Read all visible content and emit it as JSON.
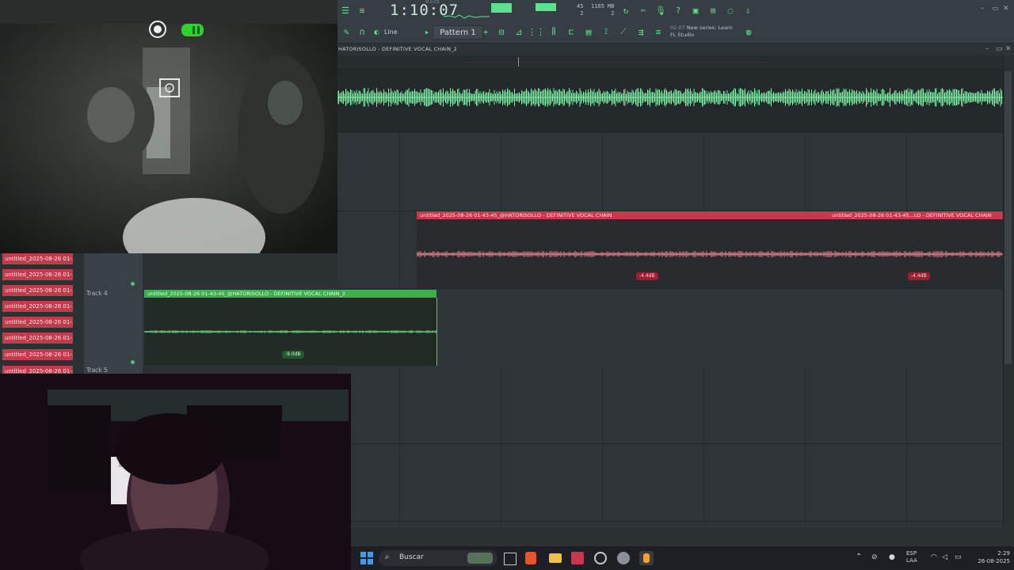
{
  "toolbar": {
    "clock": "1:10:07",
    "clock_sub": "M:S:CS",
    "voices": "45",
    "voices_sub": "2",
    "memory": "1165 MB",
    "memory_sub": "2",
    "snap": "Line",
    "pattern": "Pattern 1",
    "hint_date": "02:07",
    "hint_title": "New series: Learn",
    "hint_sub": "FL Studio"
  },
  "playlist": {
    "title": "HATORISOLLO - DEFINITIVE VOCAL CHAIN_2"
  },
  "red_clip": {
    "label_left": "untitled_2025-08-26 01-43-45_@HATORISOLLO - DEFINITIVE VOCAL CHAIN",
    "label_right": "untitled_2025-08-26 01-43-45...LO - DEFINITIVE VOCAL CHAIN",
    "vol_left": "-4.4dB",
    "vol_right": "-4.4dB"
  },
  "green_clip": {
    "label": "untitled_2025-08-26 01-43-45_@HATORISOLLO - DEFINITIVE VOCAL CHAIN_2",
    "vol": "-9.0dB"
  },
  "tracks": {
    "track4": "Track 4",
    "track5": "Track 5"
  },
  "pattern_list": [
    "untitled_2025-08-26 01-...",
    "untitled_2025-08-26 01-...",
    "untitled_2025-08-26 01-...",
    "untitled_2025-08-26 01-...",
    "untitled_2025-08-26 01-...",
    "untitled_2025-08-26 01-...",
    "untitled_2025-08-26 01-...",
    "untitled_2025-08-26 01-..."
  ],
  "taskbar": {
    "search": "Buscar",
    "lang": "ESP",
    "lang_sub": "LAA",
    "time": "2:29",
    "date": "26-08-2025"
  },
  "colors": {
    "accent": "#5fe08e",
    "clip_red": "#c8374d",
    "clip_green": "#3bb04a"
  }
}
